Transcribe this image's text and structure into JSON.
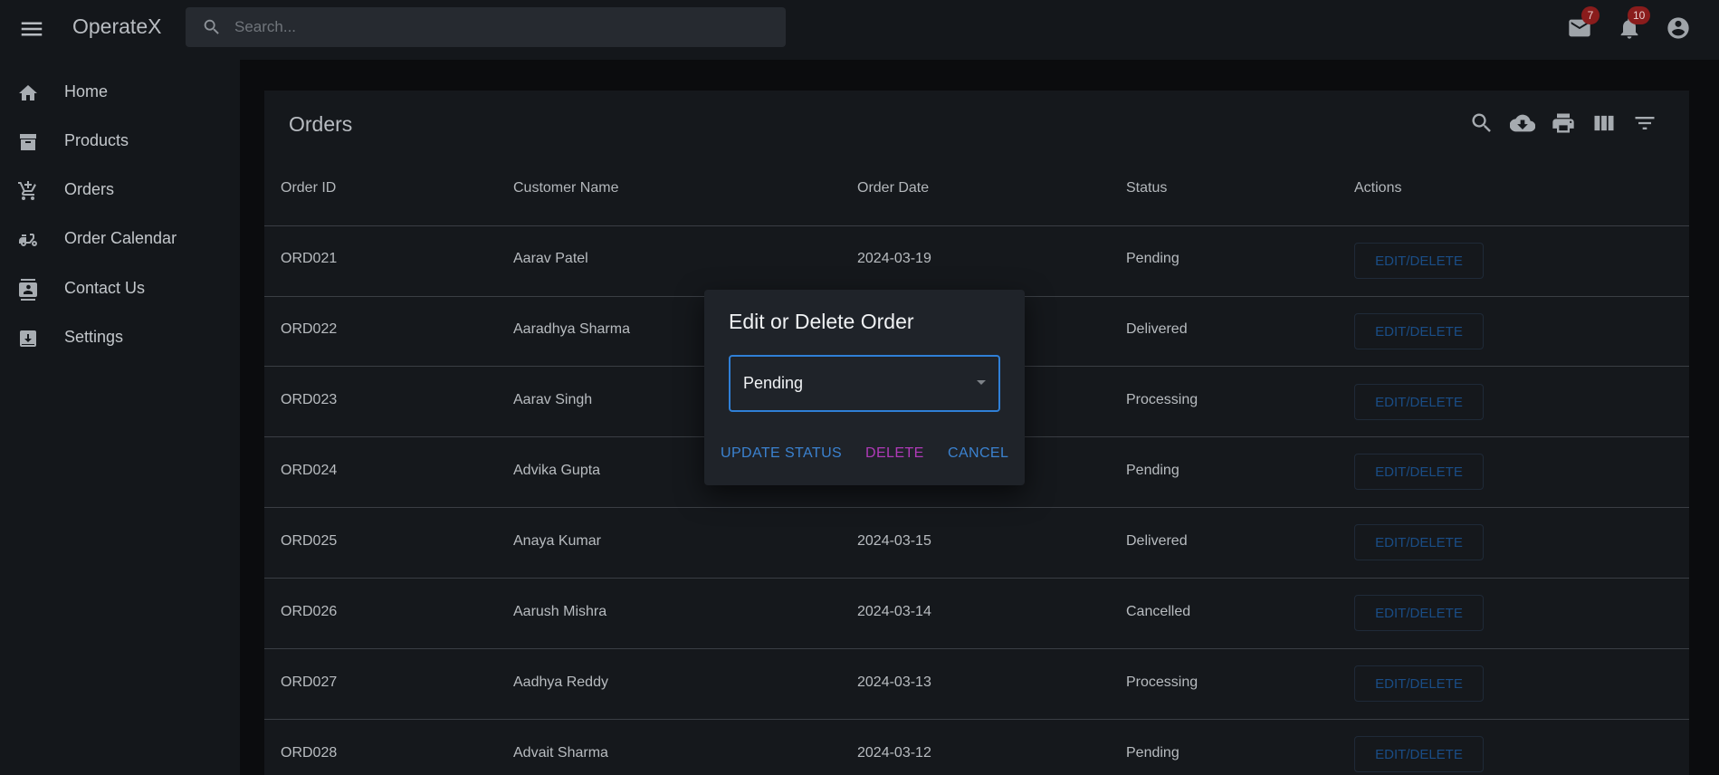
{
  "app": {
    "title": "OperateX"
  },
  "search": {
    "placeholder": "Search..."
  },
  "topbar": {
    "mail_badge": "7",
    "notifications_badge": "10"
  },
  "sidebar": {
    "items": [
      {
        "label": "Home",
        "icon": "home-icon"
      },
      {
        "label": "Products",
        "icon": "archive-icon"
      },
      {
        "label": "Orders",
        "icon": "cart-icon"
      },
      {
        "label": "Order Calendar",
        "icon": "scooter-icon"
      },
      {
        "label": "Contact Us",
        "icon": "contact-card-icon"
      },
      {
        "label": "Settings",
        "icon": "download-box-icon"
      }
    ]
  },
  "orders": {
    "title": "Orders",
    "columns": [
      "Order ID",
      "Customer Name",
      "Order Date",
      "Status",
      "Actions"
    ],
    "action_label": "EDIT/DELETE",
    "rows": [
      {
        "id": "ORD021",
        "customer": "Aarav Patel",
        "date": "2024-03-19",
        "status": "Pending"
      },
      {
        "id": "ORD022",
        "customer": "Aaradhya Sharma",
        "date": "",
        "status": "Delivered"
      },
      {
        "id": "ORD023",
        "customer": "Aarav Singh",
        "date": "",
        "status": "Processing"
      },
      {
        "id": "ORD024",
        "customer": "Advika Gupta",
        "date": "",
        "status": "Pending"
      },
      {
        "id": "ORD025",
        "customer": "Anaya Kumar",
        "date": "2024-03-15",
        "status": "Delivered"
      },
      {
        "id": "ORD026",
        "customer": "Aarush Mishra",
        "date": "2024-03-14",
        "status": "Cancelled"
      },
      {
        "id": "ORD027",
        "customer": "Aadhya Reddy",
        "date": "2024-03-13",
        "status": "Processing"
      },
      {
        "id": "ORD028",
        "customer": "Advait Sharma",
        "date": "2024-03-12",
        "status": "Pending"
      }
    ]
  },
  "dialog": {
    "title": "Edit or Delete Order",
    "selected_status": "Pending",
    "update_label": "UPDATE STATUS",
    "delete_label": "DELETE",
    "cancel_label": "CANCEL"
  },
  "colors": {
    "accent": "#2f7fd6",
    "delete": "#b03ab8",
    "badge": "#8a1c1c",
    "action_text": "#1a4d86"
  }
}
